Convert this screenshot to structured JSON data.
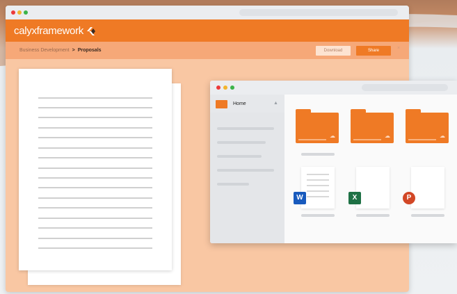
{
  "colors": {
    "accent": "#ef7a25",
    "window_bg": "#f9c7a3",
    "crumb_bg": "#f6a878",
    "word": "#185abd",
    "excel": "#1e7145",
    "powerpoint": "#d24726"
  },
  "header": {
    "brand": "calyxframework",
    "logo_icon": "calyx-logo-icon"
  },
  "breadcrumb": {
    "parent": "Business Development",
    "separator": ">",
    "current": "Proposals"
  },
  "toolbar": {
    "download_label": "Download",
    "share_label": "Share",
    "close_glyph": "×"
  },
  "file_browser": {
    "sidebar": {
      "home_label": "Home",
      "home_icon": "folder-icon",
      "up_glyph": "▲"
    },
    "files": [
      {
        "type": "word",
        "glyph": "W",
        "icon": "word-icon"
      },
      {
        "type": "excel",
        "glyph": "X",
        "icon": "excel-icon"
      },
      {
        "type": "powerpoint",
        "glyph": "P",
        "icon": "powerpoint-icon"
      }
    ],
    "folder_cloud_glyph": "☁"
  }
}
